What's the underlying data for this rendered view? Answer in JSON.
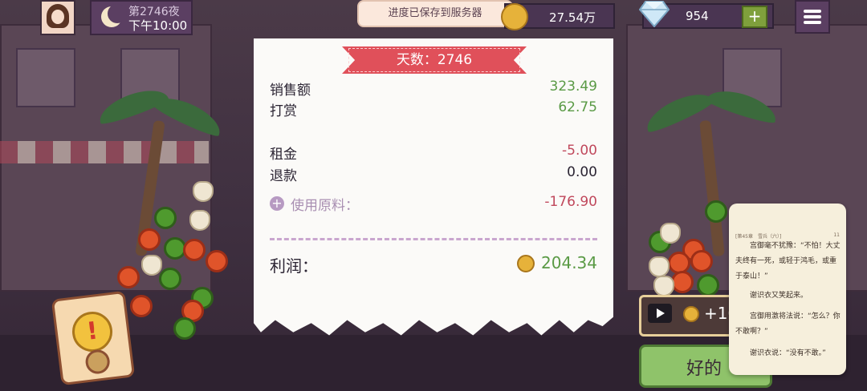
{
  "hud": {
    "day_label": "第2746夜",
    "time_label": "下午10:00",
    "save_toast": "进度已保存到服务器",
    "coins": "27.54万",
    "gems": "954",
    "plus_label": "+"
  },
  "receipt": {
    "banner": "天数：2746",
    "rows": [
      {
        "label": "销售额",
        "value": "323.49"
      },
      {
        "label": "打赏",
        "value": "62.75"
      },
      {
        "label": "租金",
        "value": "-5.00"
      },
      {
        "label": "退款",
        "value": "0.00"
      },
      {
        "label": "使用原料：",
        "value": "-176.90"
      }
    ],
    "ingredients_plus": "+",
    "profit_label": "利润：",
    "profit_value": "204.34"
  },
  "buttons": {
    "reward_label": "+10",
    "ok_label": "好的"
  },
  "alert": {
    "symbol": "!"
  },
  "reader": {
    "crumb": "[第45章　雪兵（六）]",
    "page": "11",
    "lines": [
      "宫御毫不犹豫：“不怕！大丈夫终有一死，或轻于鸿毛，或重于泰山！”",
      "谢识衣又笑起来。",
      "宫御用激将法说：“怎么？你不敢啊？”",
      "谢识衣说：“没有不敢。”"
    ]
  },
  "colors": {
    "positive": "#5a9a45",
    "negative": "#c0485c",
    "banner": "#e0505a",
    "ok_button": "#8fc36a"
  }
}
